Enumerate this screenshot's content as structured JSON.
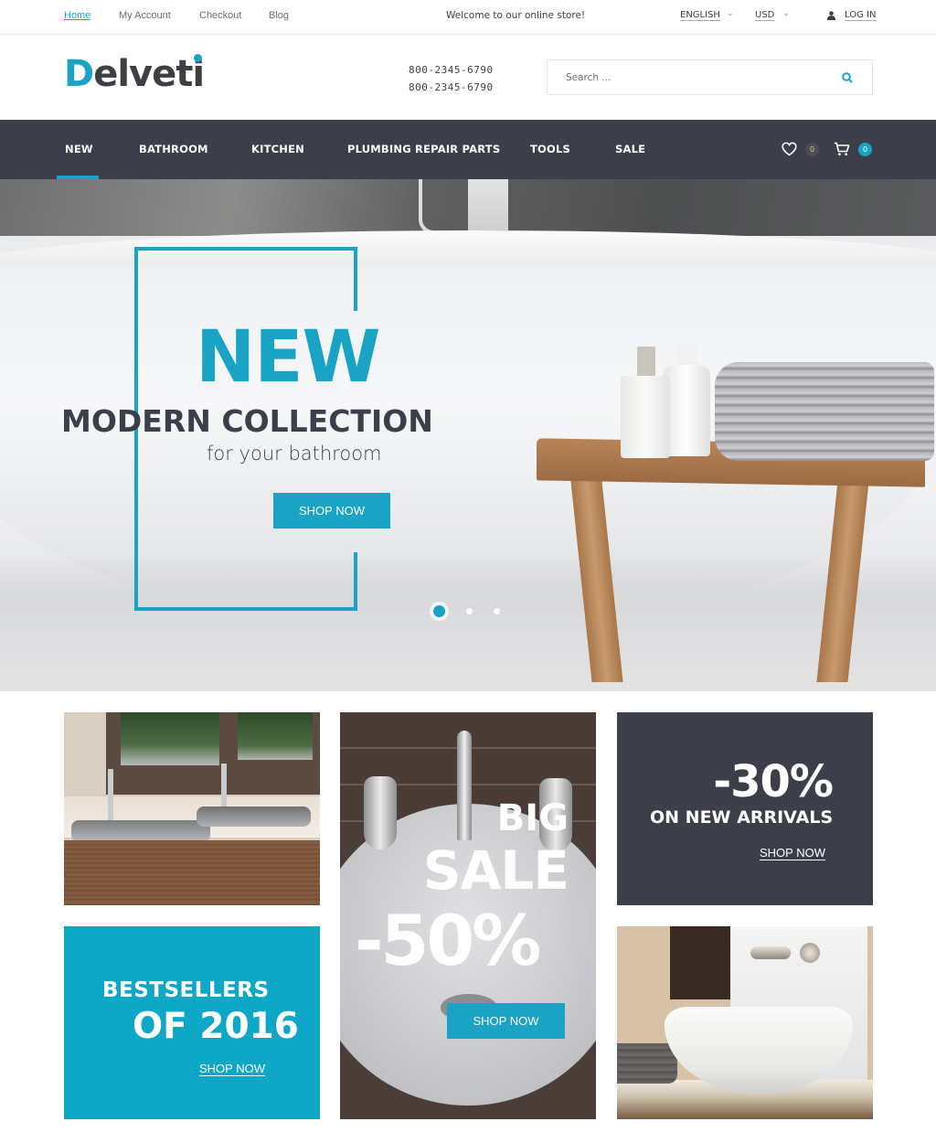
{
  "topbar": {
    "links": [
      {
        "label": "Home",
        "active": true
      },
      {
        "label": "My Account",
        "active": false
      },
      {
        "label": "Checkout",
        "active": false
      },
      {
        "label": "Blog",
        "active": false
      }
    ],
    "welcome": "Welcome to our online store!",
    "language": "ENGLISH",
    "currency": "USD",
    "login_label": "LOG IN"
  },
  "header": {
    "logo_first": "D",
    "logo_rest": "elveti",
    "phones": [
      "800-2345-6790",
      "800-2345-6790"
    ],
    "search_placeholder": "Search ..."
  },
  "nav": {
    "items": [
      {
        "label": "NEW",
        "active": true
      },
      {
        "label": "BATHROOM",
        "active": false
      },
      {
        "label": "KITCHEN",
        "active": false
      },
      {
        "label": "PLUMBING REPAIR PARTS",
        "active": false
      },
      {
        "label": "TOOLS",
        "active": false
      },
      {
        "label": "SALE",
        "active": false
      }
    ],
    "wishlist_count": "0",
    "cart_count": "0"
  },
  "hero": {
    "headline": "NEW",
    "title": "MODERN COLLECTION",
    "subtitle": "for your bathroom",
    "cta": "SHOP NOW",
    "slides": 3,
    "active_slide": 1
  },
  "banners": {
    "sale": {
      "line1": "BIG",
      "line2": "SALE",
      "line3": "-50%",
      "cta": "SHOP NOW"
    },
    "arrivals": {
      "line1": "-30%",
      "line2": "ON NEW ARRIVALS",
      "cta": "SHOP NOW"
    },
    "bestsellers": {
      "line1": "BESTSELLERS",
      "line2": "OF 2016",
      "cta": "SHOP NOW"
    }
  },
  "colors": {
    "accent": "#1aa3c4",
    "dark": "#3c3f4a",
    "text": "#3b3f4a"
  }
}
